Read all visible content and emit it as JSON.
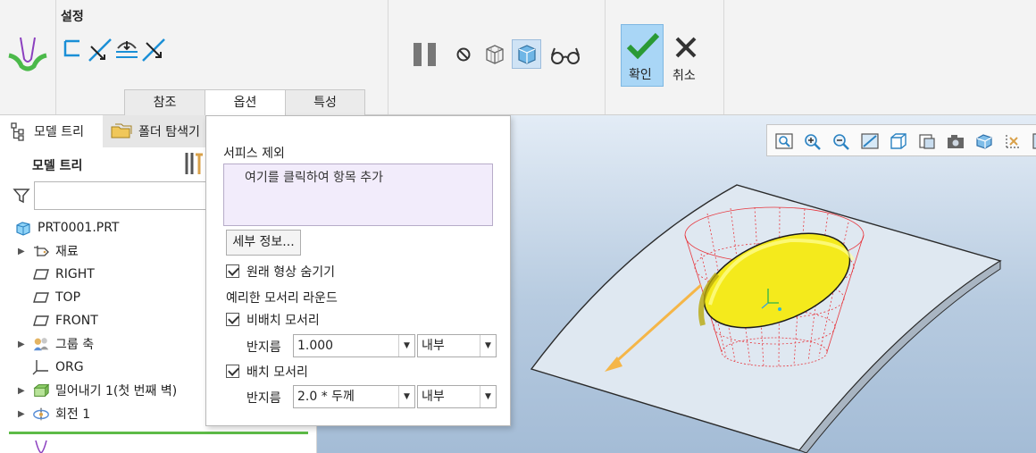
{
  "ribbon": {
    "group_title": "설정",
    "tabs": [
      "참조",
      "옵션",
      "특성"
    ],
    "confirm_label": "확인",
    "cancel_label": "취소"
  },
  "left_panel": {
    "tab_model_tree": "모델 트리",
    "tab_folder_browser": "폴더 탐색기",
    "tree_header": "모델 트리",
    "filter_value": "",
    "items": [
      {
        "label": "PRT0001.PRT",
        "icon": "part-icon"
      },
      {
        "label": "재료",
        "icon": "material-icon"
      },
      {
        "label": "RIGHT",
        "icon": "datum-plane-icon"
      },
      {
        "label": "TOP",
        "icon": "datum-plane-icon"
      },
      {
        "label": "FRONT",
        "icon": "datum-plane-icon"
      },
      {
        "label": "그룹 축",
        "icon": "group-icon"
      },
      {
        "label": "ORG",
        "icon": "coordinate-system-icon"
      },
      {
        "label": "밀어내기 1(첫 번째 벽)",
        "icon": "extrude-icon"
      },
      {
        "label": "회전 1",
        "icon": "revolve-icon"
      }
    ]
  },
  "options": {
    "exclude_surfaces_label": "서피스 제외",
    "collector_placeholder": "여기를 클릭하여 항목 추가",
    "details_button": "세부 정보...",
    "hide_original_label": "원래 형상 숨기기",
    "sharp_edges_label": "예리한 모서리 라운드",
    "non_placement_label": "비배치 모서리",
    "radius_label_1": "반지름",
    "radius_value_1": "1.000",
    "side_value_1": "내부",
    "placement_label": "배치 모서리",
    "radius_label_2": "반지름",
    "radius_value_2": "2.0 * 두께",
    "side_value_2": "내부"
  },
  "colors": {
    "ribbon_bg": "#f3f3f3",
    "confirm_highlight": "#a9d6f6",
    "collector_bg": "#f2ecfb",
    "accent_green": "#5dbb47",
    "surface_yellow": "#f4ea1c",
    "preview_red": "#e8232a",
    "arrow_orange": "#f5b648"
  }
}
